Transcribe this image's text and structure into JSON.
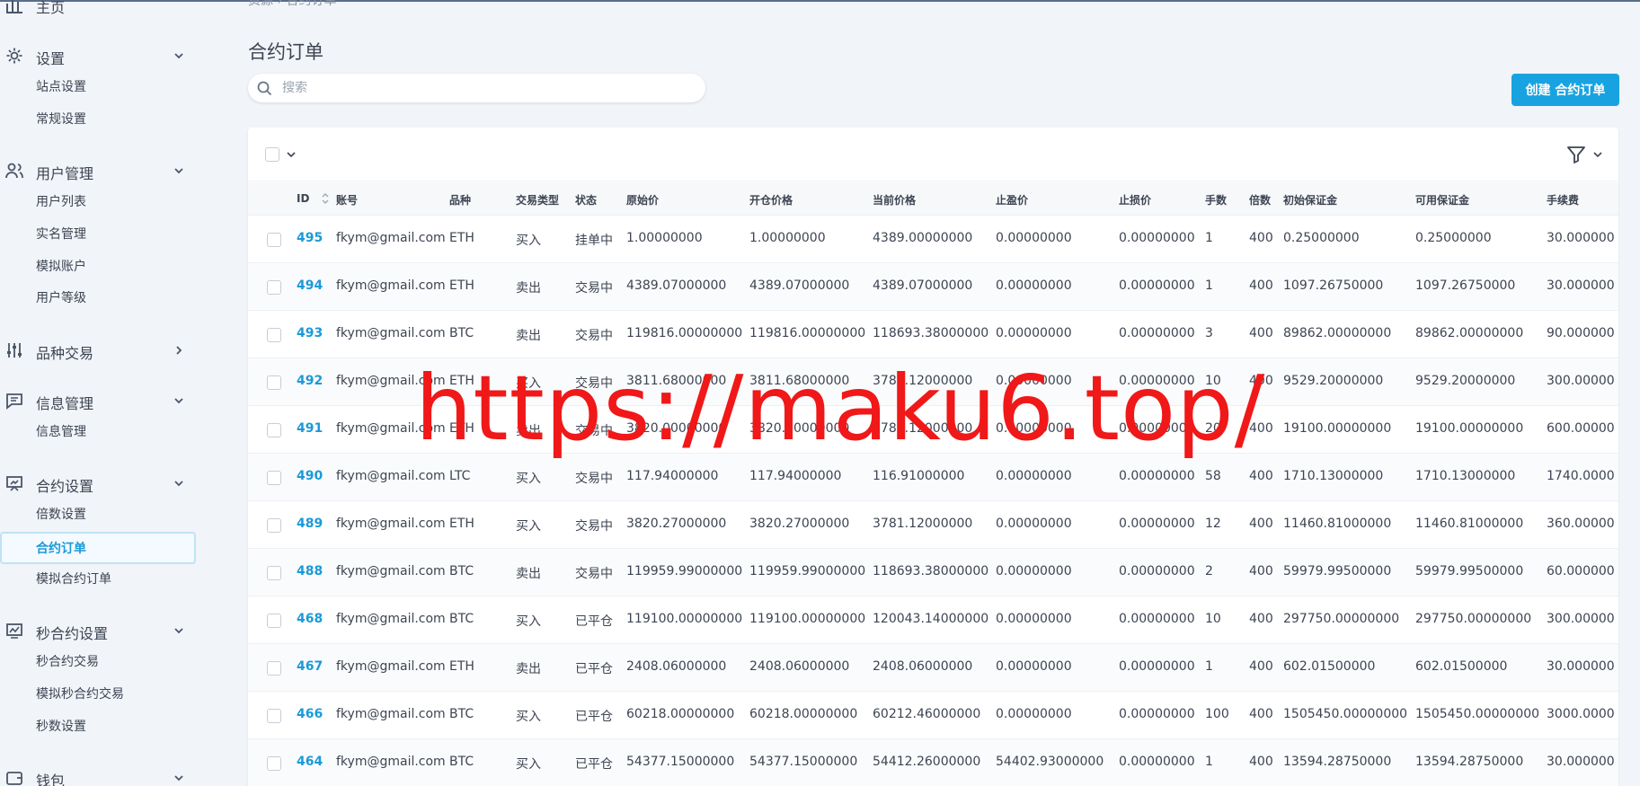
{
  "breadcrumb": [
    "资源",
    "合约订单"
  ],
  "sidebar": {
    "home": "主页",
    "groups": [
      {
        "id": "settings",
        "label": "设置",
        "items": [
          "站点设置",
          "常规设置"
        ]
      },
      {
        "id": "users",
        "label": "用户管理",
        "items": [
          "用户列表",
          "实名管理",
          "模拟账户",
          "用户等级"
        ]
      },
      {
        "id": "trading",
        "label": "品种交易",
        "items": []
      },
      {
        "id": "info",
        "label": "信息管理",
        "items": [
          "信息管理"
        ]
      },
      {
        "id": "contract",
        "label": "合约设置",
        "items": [
          "倍数设置",
          "合约订单",
          "模拟合约订单"
        ]
      },
      {
        "id": "seconds",
        "label": "秒合约设置",
        "items": [
          "秒合约交易",
          "模拟秒合约交易",
          "秒数设置"
        ]
      },
      {
        "id": "wallet",
        "label": "钱包",
        "items": []
      }
    ],
    "active": "合约订单"
  },
  "page": {
    "title": "合约订单",
    "search_placeholder": "搜索",
    "create_button": "创建 合约订单"
  },
  "table": {
    "columns": [
      "ID",
      "账号",
      "品种",
      "交易类型",
      "状态",
      "原始价",
      "开仓价格",
      "当前价格",
      "止盈价",
      "止损价",
      "手数",
      "倍数",
      "初始保证金",
      "可用保证金",
      "手续费"
    ],
    "rows": [
      [
        "495",
        "fkym@gmail.com",
        "ETH",
        "买入",
        "挂单中",
        "1.00000000",
        "1.00000000",
        "4389.00000000",
        "0.00000000",
        "0.00000000",
        "1",
        "400",
        "0.25000000",
        "0.25000000",
        "30.000000"
      ],
      [
        "494",
        "fkym@gmail.com",
        "ETH",
        "卖出",
        "交易中",
        "4389.07000000",
        "4389.07000000",
        "4389.07000000",
        "0.00000000",
        "0.00000000",
        "1",
        "400",
        "1097.26750000",
        "1097.26750000",
        "30.000000"
      ],
      [
        "493",
        "fkym@gmail.com",
        "BTC",
        "卖出",
        "交易中",
        "119816.00000000",
        "119816.00000000",
        "118693.38000000",
        "0.00000000",
        "0.00000000",
        "3",
        "400",
        "89862.00000000",
        "89862.00000000",
        "90.000000"
      ],
      [
        "492",
        "fkym@gmail.com",
        "ETH",
        "买入",
        "交易中",
        "3811.68000000",
        "3811.68000000",
        "3781.12000000",
        "0.00000000",
        "0.00000000",
        "10",
        "400",
        "9529.20000000",
        "9529.20000000",
        "300.00000"
      ],
      [
        "491",
        "fkym@gmail.com",
        "ETH",
        "卖出",
        "交易中",
        "3820.00000000",
        "3820.00000000",
        "3781.12000000",
        "0.00000000",
        "0.00000000",
        "20",
        "400",
        "19100.00000000",
        "19100.00000000",
        "600.00000"
      ],
      [
        "490",
        "fkym@gmail.com",
        "LTC",
        "买入",
        "交易中",
        "117.94000000",
        "117.94000000",
        "116.91000000",
        "0.00000000",
        "0.00000000",
        "58",
        "400",
        "1710.13000000",
        "1710.13000000",
        "1740.0000"
      ],
      [
        "489",
        "fkym@gmail.com",
        "ETH",
        "买入",
        "交易中",
        "3820.27000000",
        "3820.27000000",
        "3781.12000000",
        "0.00000000",
        "0.00000000",
        "12",
        "400",
        "11460.81000000",
        "11460.81000000",
        "360.00000"
      ],
      [
        "488",
        "fkym@gmail.com",
        "BTC",
        "卖出",
        "交易中",
        "119959.99000000",
        "119959.99000000",
        "118693.38000000",
        "0.00000000",
        "0.00000000",
        "2",
        "400",
        "59979.99500000",
        "59979.99500000",
        "60.000000"
      ],
      [
        "468",
        "fkym@gmail.com",
        "BTC",
        "买入",
        "已平仓",
        "119100.00000000",
        "119100.00000000",
        "120043.14000000",
        "0.00000000",
        "0.00000000",
        "10",
        "400",
        "297750.00000000",
        "297750.00000000",
        "300.00000"
      ],
      [
        "467",
        "fkym@gmail.com",
        "ETH",
        "卖出",
        "已平仓",
        "2408.06000000",
        "2408.06000000",
        "2408.06000000",
        "0.00000000",
        "0.00000000",
        "1",
        "400",
        "602.01500000",
        "602.01500000",
        "30.000000"
      ],
      [
        "466",
        "fkym@gmail.com",
        "BTC",
        "买入",
        "已平仓",
        "60218.00000000",
        "60218.00000000",
        "60212.46000000",
        "0.00000000",
        "0.00000000",
        "100",
        "400",
        "1505450.00000000",
        "1505450.00000000",
        "3000.0000"
      ],
      [
        "464",
        "fkym@gmail.com",
        "BTC",
        "买入",
        "已平仓",
        "54377.15000000",
        "54377.15000000",
        "54412.26000000",
        "54402.93000000",
        "0.00000000",
        "1",
        "400",
        "13594.28750000",
        "13594.28750000",
        "30.000000"
      ]
    ]
  },
  "watermark": "https://maku6.top/",
  "colors": {
    "accent": "#18a3e0",
    "link": "#1a9ad8",
    "watermark": "#f01818"
  }
}
